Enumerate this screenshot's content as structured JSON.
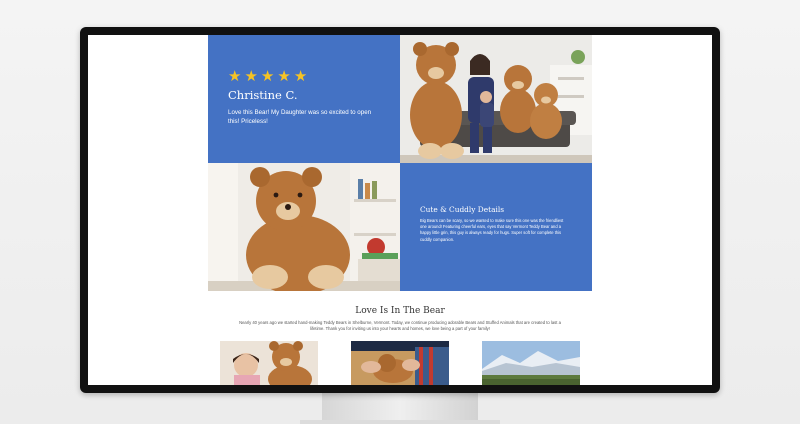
{
  "review": {
    "stars": [
      "★",
      "★",
      "★",
      "★",
      "★"
    ],
    "name": "Christine C.",
    "text": "Love this Bear! My Daughter was so excited to open this! Priceless!"
  },
  "details": {
    "title": "Cute & Cuddly Details",
    "text": "Big Bears can be scary, so we wanted to make sure this one was the friendliest one around! Featuring cheerful ears, eyes that say Vermont Teddy Bear and a happy little grin, this guy is always ready for hugs. Super soft for complete this cuddly companion."
  },
  "section": {
    "title": "Love Is In The Bear",
    "text": "Nearly 40 years ago we started hand-making Teddy Bears in Shelburne, Vermont. Today, we continue producing adorable Bears and Stuffed Animals that are created to last a lifetime. Thank you for inviting us into your hearts and homes, we love being a part of your family!"
  },
  "colors": {
    "accent_blue": "#4472c4",
    "star_yellow": "#f5c325",
    "bear_brown": "#b8753a"
  },
  "icons": [
    "star-icon"
  ]
}
